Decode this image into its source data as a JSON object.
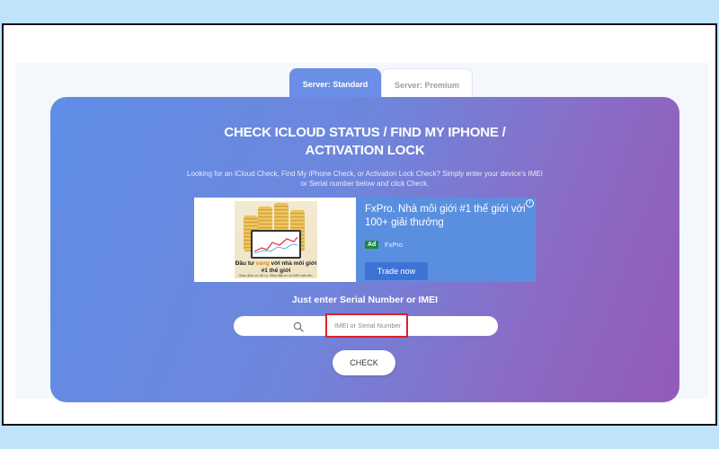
{
  "tabs": [
    {
      "label": "Server: Standard",
      "active": true
    },
    {
      "label": "Server: Premium",
      "active": false
    }
  ],
  "main": {
    "title_line1": "CHECK ICLOUD STATUS / FIND MY IPHONE /",
    "title_line2": "ACTIVATION LOCK",
    "subtitle": "Looking for an iCloud Check, Find My iPhone Check, or Activation Lock Check? Simply enter your device's IMEI or Serial number below and click Check."
  },
  "ad": {
    "image_caption_prefix": "Đầu tư ",
    "image_caption_accent": "vàng",
    "image_caption_suffix": " với nhà môi giới #1 thế giới",
    "image_fine_print": "Giao dịch có rủi ro. Nhà đầu tư có thể mất vốn.",
    "headline": "FxPro. Nhà môi giới #1 thế giới với 100+ giải thưởng",
    "badge": "Ad",
    "brand": "FxPro",
    "cta": "Trade now",
    "info_icon": "info-icon"
  },
  "search": {
    "prompt": "Just enter Serial Number or IMEI",
    "placeholder": "IMEI or Serial Number",
    "value": "",
    "icon": "search-icon"
  },
  "check_button": {
    "label": "CHECK"
  },
  "colors": {
    "page_background": "#bfe3fb",
    "card_gradient_start": "#5f8de6",
    "card_gradient_end": "#935ab9",
    "active_tab": "#6b8ee6",
    "highlight_border": "#e0202a",
    "ad_panel": "#5a8fe0"
  }
}
